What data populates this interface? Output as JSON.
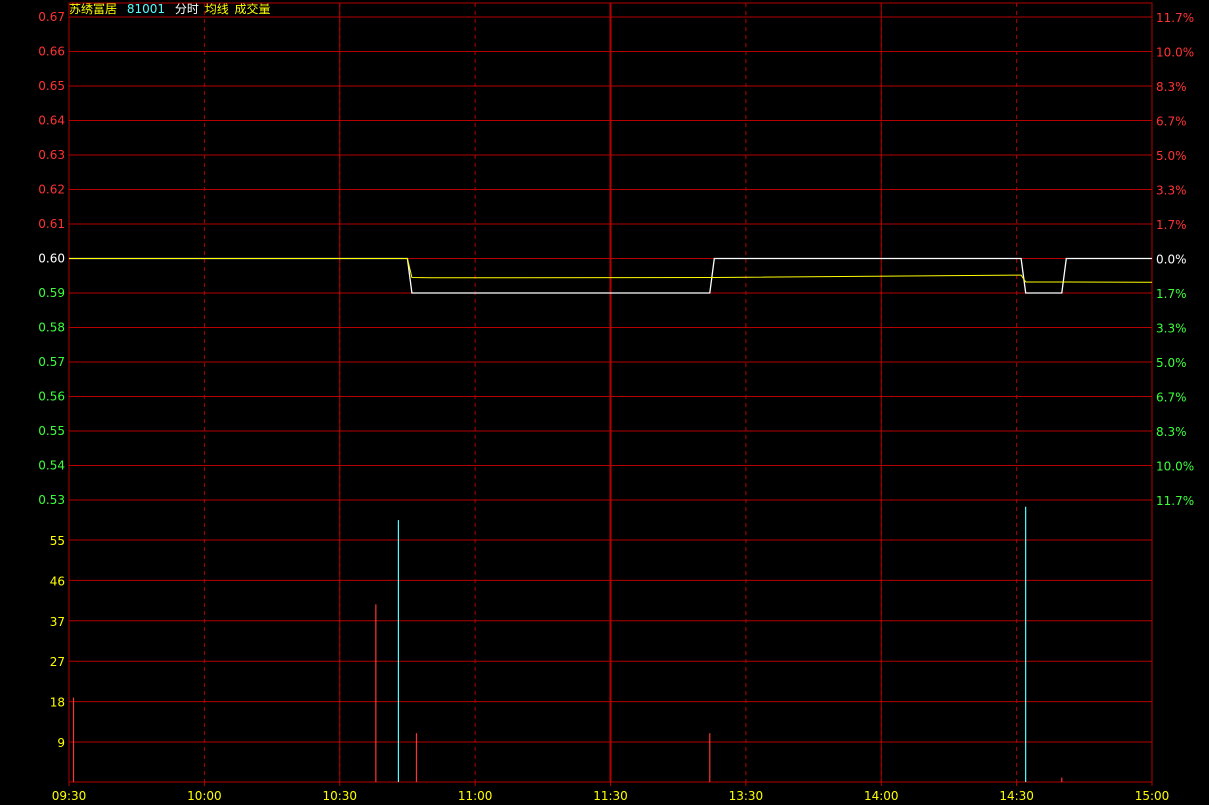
{
  "header": {
    "stock_name": "苏绣富居",
    "stock_code": "81001",
    "label_intraday": "分时",
    "label_avg": "均线",
    "label_volume": "成交量"
  },
  "colors": {
    "background": "#000000",
    "grid": "#b40000",
    "up": "#ff3232",
    "down": "#3cff3c",
    "neutral": "#ffffff",
    "avg_line": "#ffff00",
    "volume_label": "#ffff00",
    "volume_up": "#ff3232",
    "volume_down": "#54ffff"
  },
  "chart_data": {
    "type": "line",
    "title": "",
    "prev_close": 0.6,
    "x_ticks": [
      "09:30",
      "10:00",
      "10:30",
      "11:00",
      "11:30",
      "13:30",
      "14:00",
      "14:30",
      "15:00"
    ],
    "price_axis": {
      "ylim": [
        0.53,
        0.67
      ],
      "ticks": [
        "0.67",
        "0.66",
        "0.65",
        "0.64",
        "0.63",
        "0.62",
        "0.61",
        "0.60",
        "0.59",
        "0.58",
        "0.57",
        "0.56",
        "0.55",
        "0.54",
        "0.53"
      ]
    },
    "pct_axis": {
      "ticks": [
        "11.7%",
        "10.0%",
        "8.3%",
        "6.7%",
        "5.0%",
        "3.3%",
        "1.7%",
        "0.0%",
        "1.7%",
        "3.3%",
        "5.0%",
        "6.7%",
        "8.3%",
        "10.0%",
        "11.7%"
      ]
    },
    "volume_axis": {
      "ylim": [
        0,
        64
      ],
      "ticks": [
        "55",
        "46",
        "37",
        "27",
        "18",
        "9"
      ]
    },
    "series": [
      {
        "key": "price",
        "x": [
          "09:30",
          "10:45",
          "10:46",
          "13:22",
          "13:23",
          "14:31",
          "14:32",
          "14:40",
          "14:41",
          "15:00"
        ],
        "values": [
          0.6,
          0.6,
          0.59,
          0.59,
          0.6,
          0.6,
          0.59,
          0.59,
          0.6,
          0.6
        ]
      },
      {
        "key": "average",
        "x": [
          "09:30",
          "10:45",
          "10:46",
          "10:50",
          "13:23",
          "14:31",
          "14:32",
          "14:41",
          "15:00"
        ],
        "values": [
          0.6,
          0.6,
          0.5945,
          0.5944,
          0.5945,
          0.5952,
          0.5932,
          0.5932,
          0.5931
        ]
      }
    ],
    "volume": [
      {
        "time": "09:31",
        "value": 19,
        "direction": "up"
      },
      {
        "time": "10:38",
        "value": 40,
        "direction": "up"
      },
      {
        "time": "10:43",
        "value": 59,
        "direction": "down"
      },
      {
        "time": "10:47",
        "value": 11,
        "direction": "up"
      },
      {
        "time": "13:22",
        "value": 11,
        "direction": "up"
      },
      {
        "time": "14:32",
        "value": 62,
        "direction": "down"
      },
      {
        "time": "14:40",
        "value": 1,
        "direction": "up"
      }
    ]
  }
}
